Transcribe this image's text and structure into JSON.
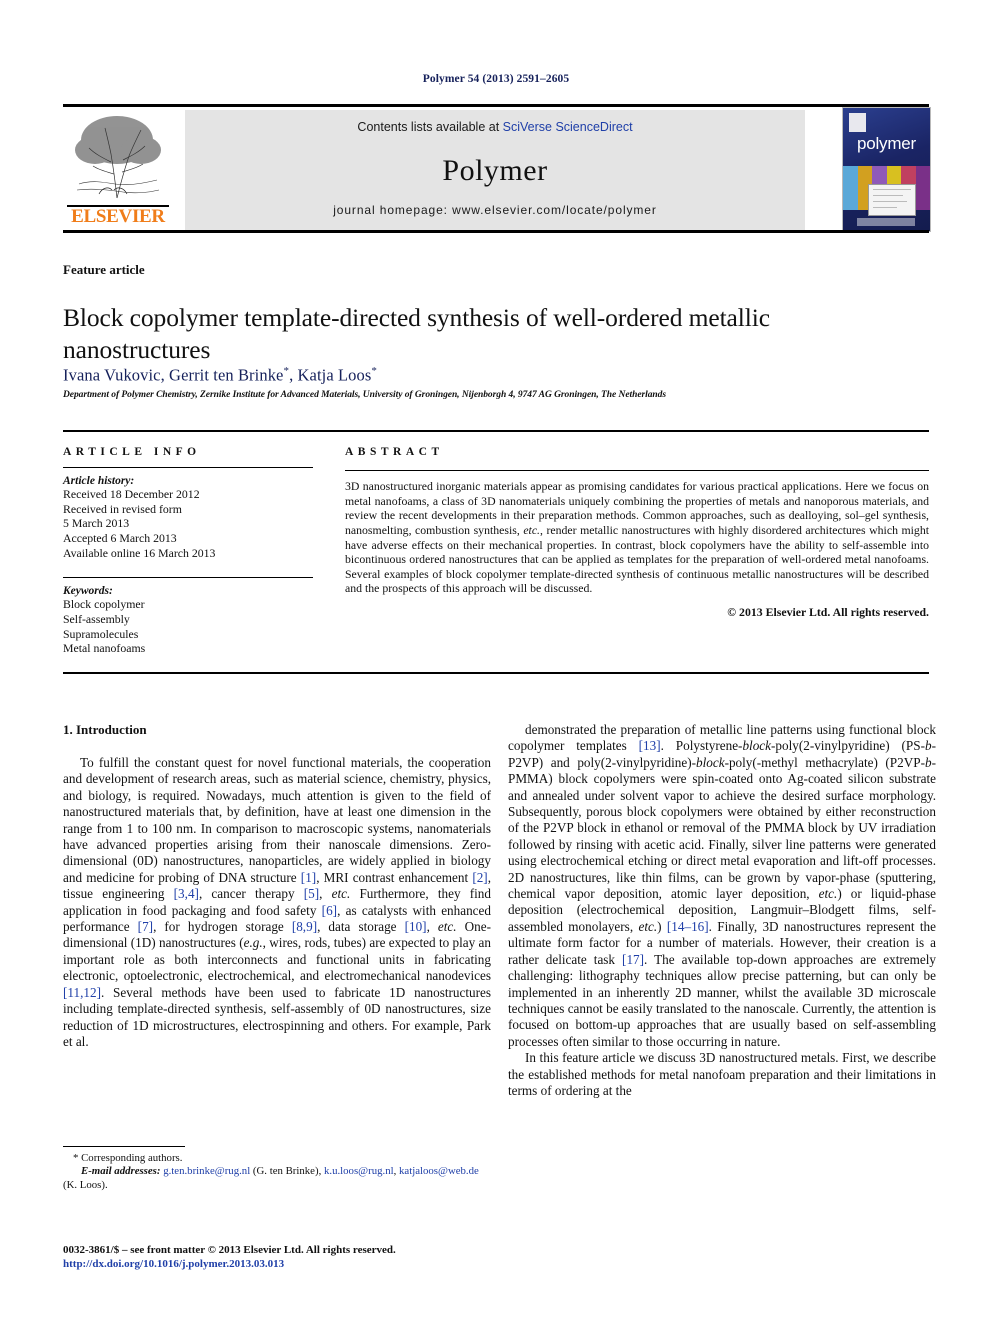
{
  "running_head": "Polymer 54 (2013) 2591–2605",
  "masthead": {
    "contents_prefix": "Contents lists available at ",
    "sciencedirect": "SciVerse ScienceDirect",
    "journal_title": "Polymer",
    "homepage": "journal homepage: www.elsevier.com/locate/polymer",
    "publisher_logo_text": "ELSEVIER",
    "cover_title": "polymer",
    "accent_link_color": "#1f3fa8",
    "band_color": "#e4e4e4",
    "elsevier_orange": "#f07d1a"
  },
  "article": {
    "feature_label": "Feature article",
    "title": "Block copolymer template-directed synthesis of well-ordered metallic nanostructures",
    "authors_html": "Ivana Vukovic, Gerrit ten Brinke<sup>*</sup>, Katja Loos<sup>*</sup>",
    "affiliation": "Department of Polymer Chemistry, Zernike Institute for Advanced Materials, University of Groningen, Nijenborgh 4, 9747 AG Groningen, The Netherlands"
  },
  "article_info": {
    "heading": "ARTICLE INFO",
    "history_label": "Article history:",
    "history": [
      "Received 18 December 2012",
      "Received in revised form",
      "5 March 2013",
      "Accepted 6 March 2013",
      "Available online 16 March 2013"
    ],
    "keywords_label": "Keywords:",
    "keywords": [
      "Block copolymer",
      "Self-assembly",
      "Supramolecules",
      "Metal nanofoams"
    ]
  },
  "abstract": {
    "heading": "ABSTRACT",
    "text_html": "3D nanostructured inorganic materials appear as promising candidates for various practical applications. Here we focus on metal nanofoams, a class of 3D nanomaterials uniquely combining the properties of metals and nanoporous materials, and review the recent developments in their preparation methods. Common approaches, such as dealloying, sol–gel synthesis, nanosmelting, combustion synthesis, <i>etc.</i>, render metallic nanostructures with highly disordered architectures which might have adverse effects on their mechanical properties. In contrast, block copolymers have the ability to self-assemble into bicontinuous ordered nanostructures that can be applied as templates for the preparation of well-ordered metal nanofoams. Several examples of block copolymer template-directed synthesis of continuous metallic nanostructures will be described and the prospects of this approach will be discussed.",
    "copyright": "© 2013 Elsevier Ltd. All rights reserved."
  },
  "body": {
    "section_title": "1. Introduction",
    "left_paragraph_html": "To fulfill the constant quest for novel functional materials, the cooperation and development of research areas, such as material science, chemistry, physics, and biology, is required. Nowadays, much attention is given to the field of nanostructured materials that, by definition, have at least one dimension in the range from 1 to 100 nm. In comparison to macroscopic systems, nanomaterials have advanced properties arising from their nanoscale dimensions. Zero-dimensional (0D) nanostructures, nanoparticles, are widely applied in biology and medicine for probing of DNA structure <span class=\"ref\">[1]</span>, MRI contrast enhancement <span class=\"ref\">[2]</span>, tissue engineering <span class=\"ref\">[3,4]</span>, cancer therapy <span class=\"ref\">[5]</span>, <i>etc.</i> Furthermore, they find application in food packaging and food safety <span class=\"ref\">[6]</span>, as catalysts with enhanced performance <span class=\"ref\">[7]</span>, for hydrogen storage <span class=\"ref\">[8,9]</span>, data storage <span class=\"ref\">[10]</span>, <i>etc.</i> One-dimensional (1D) nanostructures (<i>e.g.</i>, wires, rods, tubes) are expected to play an important role as both interconnects and functional units in fabricating electronic, optoelectronic, electrochemical, and electromechanical nanodevices <span class=\"ref\">[11,12]</span>. Several methods have been used to fabricate 1D nanostructures including template-directed synthesis, self-assembly of 0D nanostructures, size reduction of 1D microstructures, electrospinning and others. For example, Park et al.",
    "right_paragraph_1_html": "demonstrated the preparation of metallic line patterns using functional block copolymer templates <span class=\"ref\">[13]</span>. Polystyrene-<i>block</i>-poly(2-vinylpyridine) (PS-<i>b</i>-P2VP) and poly(2-vinylpyridine)-<i>block</i>-poly(-methyl methacrylate) (P2VP-<i>b</i>-PMMA) block copolymers were spin-coated onto Ag-coated silicon substrate and annealed under solvent vapor to achieve the desired surface morphology. Subsequently, porous block copolymers were obtained by either reconstruction of the P2VP block in ethanol or removal of the PMMA block by UV irradiation followed by rinsing with acetic acid. Finally, silver line patterns were generated using electrochemical etching or direct metal evaporation and lift-off processes. 2D nanostructures, like thin films, can be grown by vapor-phase (sputtering, chemical vapor deposition, atomic layer deposition, <i>etc.</i>) or liquid-phase deposition (electrochemical deposition, Langmuir–Blodgett films, self-assembled monolayers, <i>etc.</i>) <span class=\"ref\">[14–16]</span>. Finally, 3D nanostructures represent the ultimate form factor for a number of materials. However, their creation is a rather delicate task <span class=\"ref\">[17]</span>. The available top-down approaches are extremely challenging: lithography techniques allow precise patterning, but can only be implemented in an inherently 2D manner, whilst the available 3D microscale techniques cannot be easily translated to the nanoscale. Currently, the attention is focused on bottom-up approaches that are usually based on self-assembling processes often similar to those occurring in nature.",
    "right_paragraph_2_html": "In this feature article we discuss 3D nanostructured metals. First, we describe the established methods for metal nanofoam preparation and their limitations in terms of ordering at the"
  },
  "footnotes": {
    "corresponding": "* Corresponding authors.",
    "email_label": "E-mail addresses:",
    "email_html": "<span class=\"mail\">g.ten.brinke@rug.nl</span> (G. ten Brinke), <span class=\"mail\">k.u.loos@rug.nl</span>, <span class=\"mail\">katjaloos@web.de</span> (K. Loos).",
    "front_matter": "0032-3861/$ – see front matter © 2013 Elsevier Ltd. All rights reserved.",
    "doi": "http://dx.doi.org/10.1016/j.polymer.2013.03.013"
  }
}
